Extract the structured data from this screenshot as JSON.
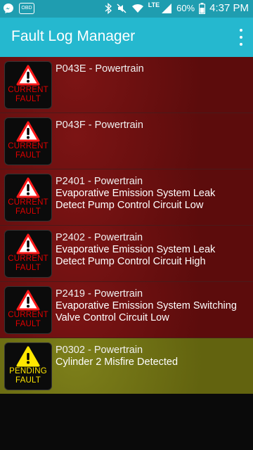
{
  "status_bar": {
    "notif_label": "OBD",
    "network_label": "LTE",
    "battery_pct": "60%",
    "time": "4:37 PM",
    "icons": [
      "messenger-icon",
      "obd-icon",
      "bluetooth-icon",
      "mute-icon",
      "wifi-icon",
      "signal-icon",
      "battery-icon"
    ]
  },
  "app_bar": {
    "title": "Fault Log Manager",
    "menu_icon": "overflow-menu-icon"
  },
  "colors": {
    "status_bar": "#1f9db0",
    "app_bar": "#25b8cf",
    "current_fault_row": "#6e1010",
    "pending_fault_row": "#6f7012",
    "current_badge_text": "#e10000",
    "pending_badge_text": "#ffe600"
  },
  "faults": [
    {
      "code": "P043E - Powertrain",
      "desc": "",
      "badge_line1": "CURRENT",
      "badge_line2": "FAULT",
      "status": "current"
    },
    {
      "code": "P043F - Powertrain",
      "desc": "",
      "badge_line1": "CURRENT",
      "badge_line2": "FAULT",
      "status": "current"
    },
    {
      "code": "P2401 - Powertrain",
      "desc": "Evaporative Emission System Leak Detect Pump Control Circuit Low",
      "badge_line1": "CURRENT",
      "badge_line2": "FAULT",
      "status": "current"
    },
    {
      "code": "P2402 - Powertrain",
      "desc": "Evaporative Emission System Leak Detect Pump Control Circuit High",
      "badge_line1": "CURRENT",
      "badge_line2": "FAULT",
      "status": "current"
    },
    {
      "code": "P2419 - Powertrain",
      "desc": "Evaporative Emission System Switching Valve Control Circuit Low",
      "badge_line1": "CURRENT",
      "badge_line2": "FAULT",
      "status": "current"
    },
    {
      "code": "P0302 - Powertrain",
      "desc": "Cylinder 2 Misfire Detected",
      "badge_line1": "PENDING",
      "badge_line2": "FAULT",
      "status": "pending"
    }
  ]
}
